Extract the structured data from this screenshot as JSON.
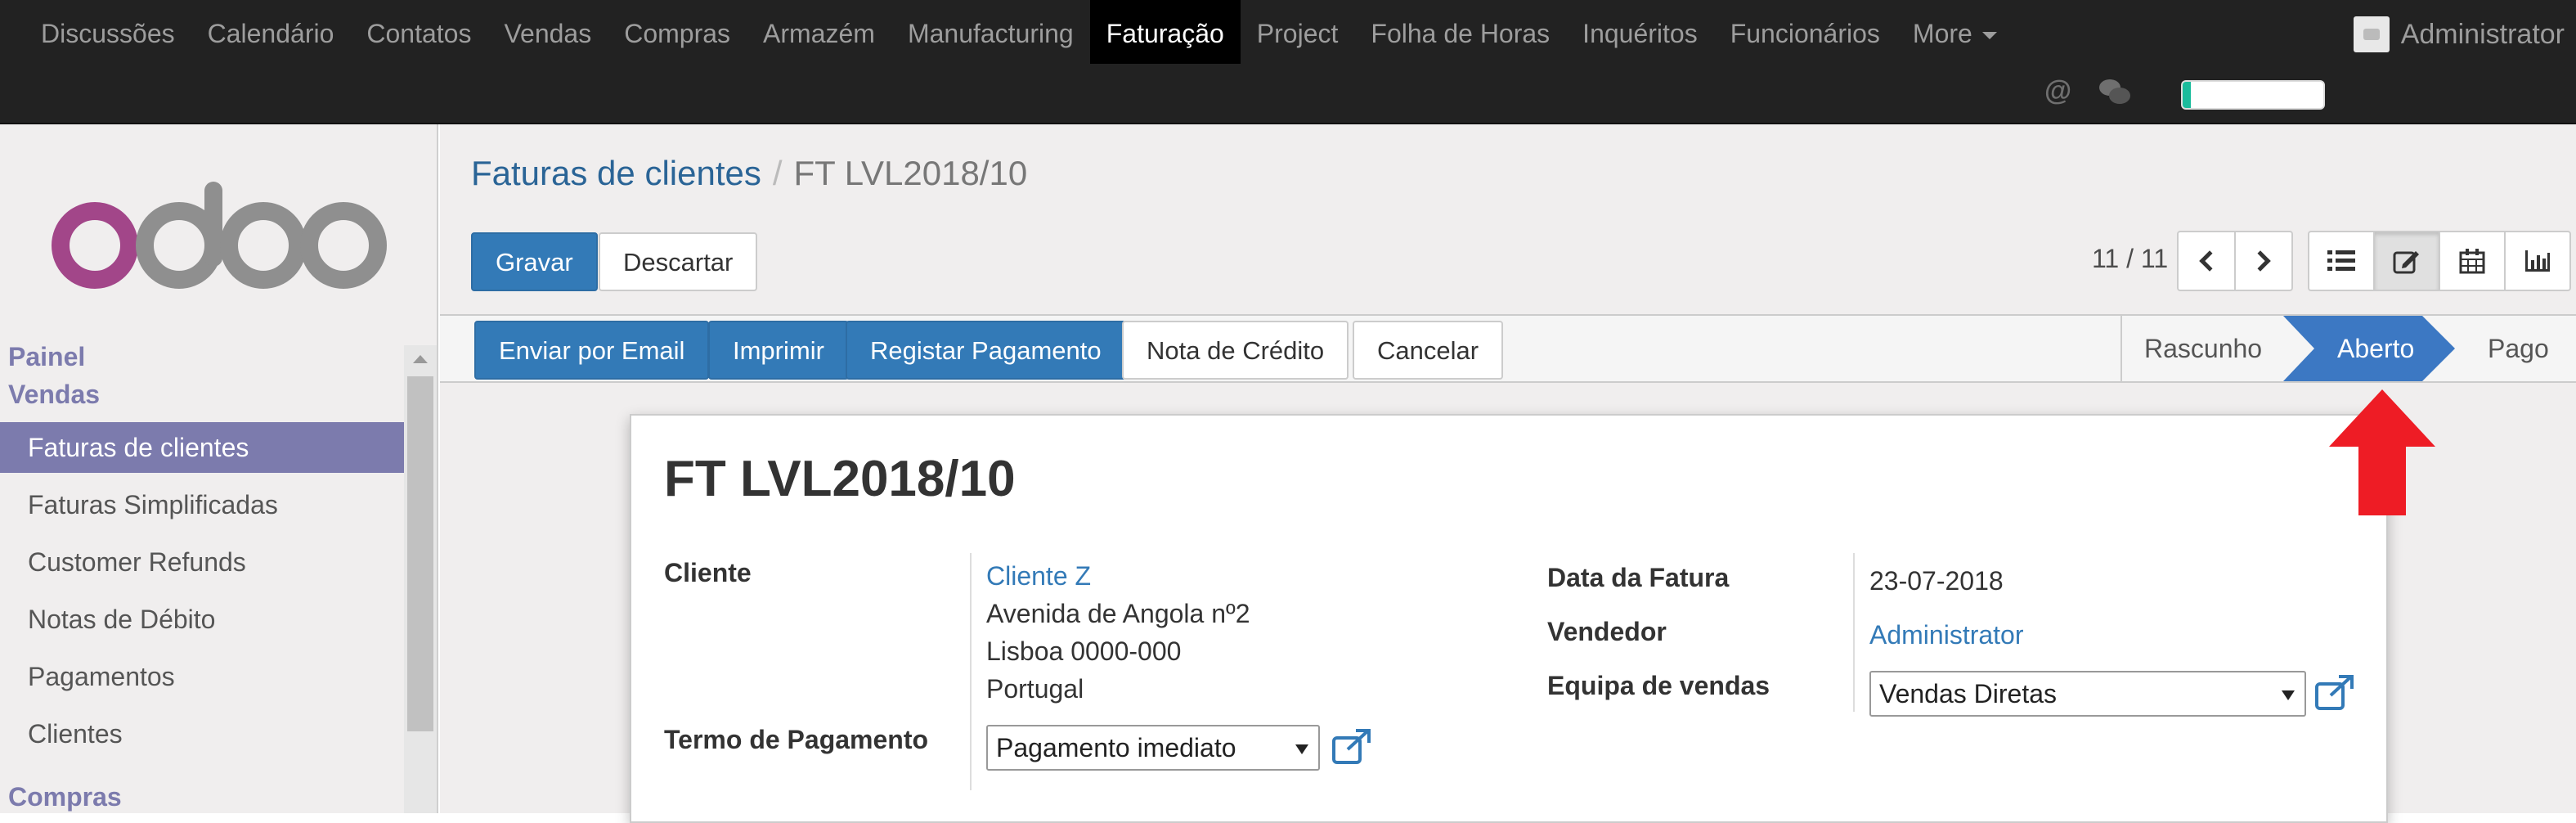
{
  "topbar": {
    "menu": [
      {
        "label": "Discussões"
      },
      {
        "label": "Calendário"
      },
      {
        "label": "Contatos"
      },
      {
        "label": "Vendas"
      },
      {
        "label": "Compras"
      },
      {
        "label": "Armazém"
      },
      {
        "label": "Manufacturing"
      },
      {
        "label": "Faturação",
        "active": true
      },
      {
        "label": "Project"
      },
      {
        "label": "Folha de Horas"
      },
      {
        "label": "Inquéritos"
      },
      {
        "label": "Funcionários"
      },
      {
        "label": "More"
      }
    ],
    "user_name": "Administrator",
    "at_symbol": "@",
    "progress": 0.06,
    "progress_color": "#1abc9c"
  },
  "sidebar": {
    "logo_text": "odoo",
    "sections": [
      "Painel",
      "Vendas",
      "Compras"
    ],
    "items": [
      {
        "label": "Faturas de clientes",
        "active": true
      },
      {
        "label": "Faturas Simplificadas"
      },
      {
        "label": "Customer Refunds"
      },
      {
        "label": "Notas de Débito"
      },
      {
        "label": "Pagamentos"
      },
      {
        "label": "Clientes"
      }
    ]
  },
  "breadcrumb": {
    "parent": "Faturas de clientes",
    "separator": "/",
    "current": "FT LVL2018/10"
  },
  "toolbar": {
    "save_label": "Gravar",
    "discard_label": "Descartar",
    "pager": "11 / 11",
    "views": [
      "list-view-icon",
      "form-view-icon",
      "calendar-view-icon",
      "graph-view-icon"
    ]
  },
  "statusbar": {
    "actions": [
      "Enviar por Email",
      "Imprimir",
      "Registar Pagamento",
      "Nota de Crédito",
      "Cancelar"
    ],
    "stages": [
      "Rascunho",
      "Aberto",
      "Pago"
    ],
    "active_stage": "Aberto",
    "active_color": "#3c78c3"
  },
  "form": {
    "title": "FT LVL2018/10",
    "customer_label": "Cliente",
    "customer_name": "Cliente Z",
    "address": [
      "Avenida de Angola nº2",
      "Lisboa 0000-000",
      "Portugal"
    ],
    "payment_term_label": "Termo de Pagamento",
    "payment_term_value": "Pagamento imediato",
    "invoice_date_label": "Data da Fatura",
    "invoice_date_value": "23-07-2018",
    "salesperson_label": "Vendedor",
    "salesperson_value": "Administrator",
    "sales_team_label": "Equipa de vendas",
    "sales_team_value": "Vendas Diretas"
  },
  "annotation": {
    "arrow_color": "#ee1c25"
  }
}
